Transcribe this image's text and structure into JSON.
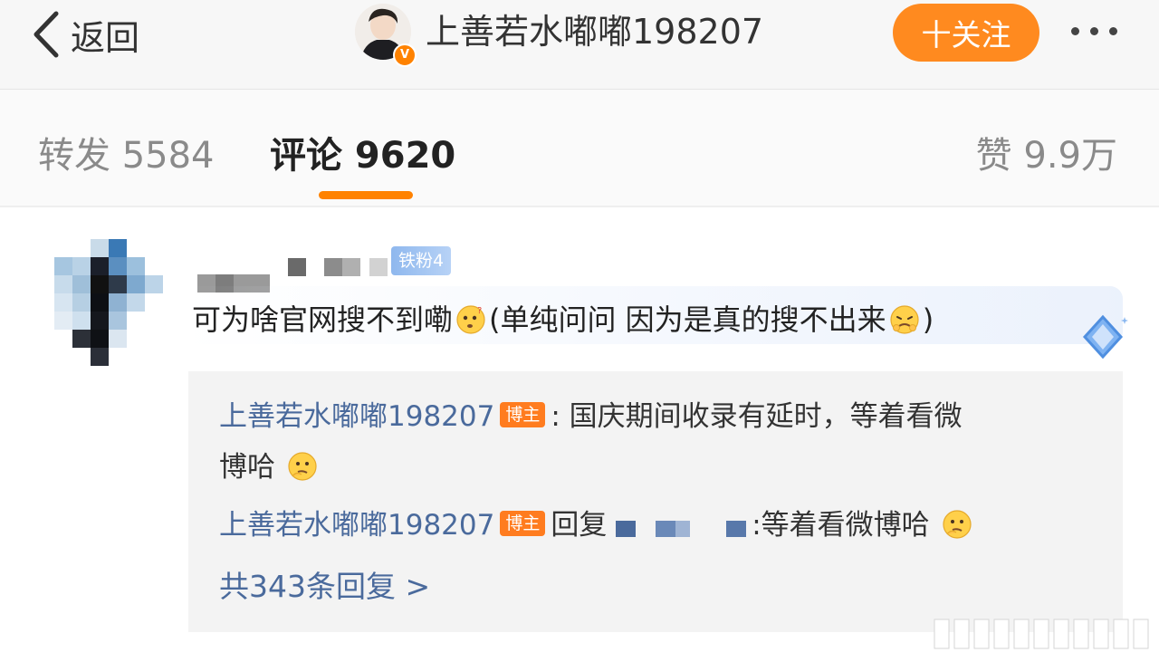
{
  "header": {
    "back_label": "返回",
    "author_name": "上善若水嘟嘟198207",
    "verified_badge": "V",
    "follow_label": "十关注",
    "more_icon": "more-dots-icon"
  },
  "tabs": {
    "repost": "转发 5584",
    "comment": "评论 9620",
    "like": "赞 9.9万"
  },
  "comment": {
    "fan_badge": "铁粉4",
    "text_part1": "可为啥官网搜不到嘞",
    "text_part2": "(单纯问问 因为是真的搜不出来",
    "text_part3": ")"
  },
  "replies": {
    "reply1_author": "上善若水嘟嘟198207",
    "reply1_tag": "博主",
    "reply1_text": ": 国庆期间收录有延时，等着看微",
    "reply1_text_cont": "博哈",
    "reply2_author": "上善若水嘟嘟198207",
    "reply2_tag": "博主",
    "reply2_prefix": "回复",
    "reply2_text": ":等着看微博哈",
    "more": "共343条回复 >"
  },
  "colors": {
    "accent": "#ff8200",
    "link": "#4a6a9c"
  }
}
